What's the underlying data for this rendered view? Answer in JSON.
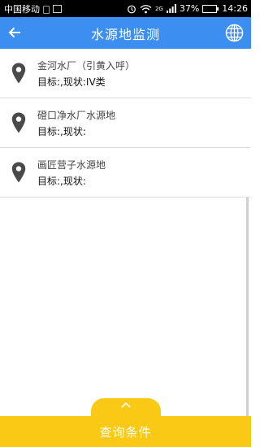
{
  "status_bar": {
    "carrier": "中国移动",
    "network": "2G",
    "battery_percent": "37%",
    "battery_level": 0.37,
    "time": "14:26"
  },
  "header": {
    "title": "水源地监测",
    "back_icon": "back-arrow-icon",
    "globe_icon": "globe-icon",
    "accent_color": "#3c8ff0"
  },
  "sites": [
    {
      "name": "金河水厂（引黄入呼）",
      "status": "目标:,现状:IV类"
    },
    {
      "name": "磴口净水厂水源地",
      "status": "目标:,现状:"
    },
    {
      "name": "画匠营子水源地",
      "status": "目标:,现状:"
    }
  ],
  "footer": {
    "query_label": "查询条件",
    "expand_icon": "chevron-up-icon",
    "color": "#f9c915"
  }
}
